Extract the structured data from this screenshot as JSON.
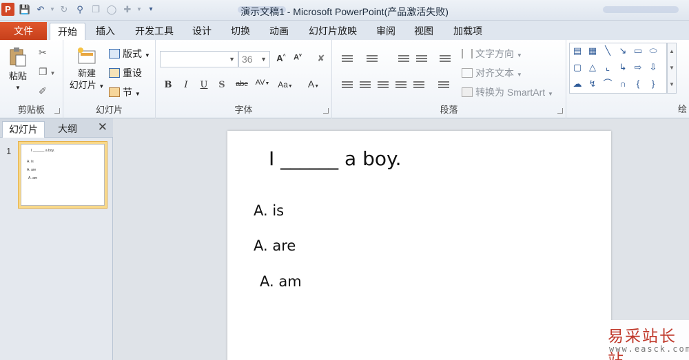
{
  "window": {
    "title": "演示文稿1 - Microsoft PowerPoint(产品激活失败)"
  },
  "tabs": [
    "文件",
    "开始",
    "插入",
    "开发工具",
    "设计",
    "切换",
    "动画",
    "幻灯片放映",
    "审阅",
    "视图",
    "加载项"
  ],
  "ribbon": {
    "clipboard": {
      "paste": "粘贴",
      "label": "剪贴板"
    },
    "slides": {
      "new_slide_line1": "新建",
      "new_slide_line2": "幻灯片",
      "layout": "版式",
      "reset": "重设",
      "section": "节",
      "label": "幻灯片"
    },
    "font": {
      "size": "36",
      "label": "字体"
    },
    "paragraph": {
      "text_direction": "文字方向",
      "align_text": "对齐文本",
      "convert_smartart": "转换为 SmartArt",
      "label": "段落"
    },
    "drawing": {
      "label": "绘"
    }
  },
  "panel": {
    "tab_slides": "幻灯片",
    "tab_outline": "大纲",
    "slide_number": "1"
  },
  "slide": {
    "title": "I ______ a boy.",
    "options": [
      "A.  is",
      "A.  are",
      "A.  am"
    ]
  },
  "watermark": {
    "brand": "易采站长站",
    "url": "www.easck.com"
  },
  "colors": {
    "file_tab": "#d24726",
    "accent": "#2f5b98"
  }
}
